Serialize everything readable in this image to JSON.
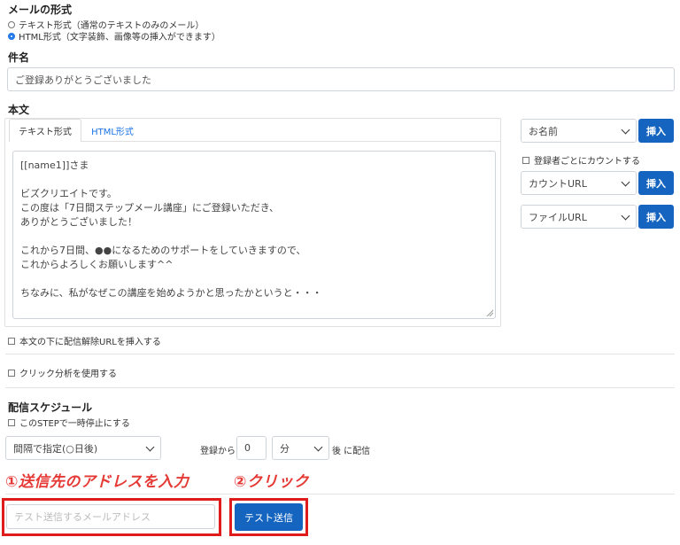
{
  "format": {
    "label": "メールの形式",
    "options": [
      {
        "label": "テキスト形式（通常のテキストのみのメール）",
        "selected": false
      },
      {
        "label": "HTML形式（文字装飾、画像等の挿入ができます）",
        "selected": true
      }
    ]
  },
  "subject": {
    "label": "件名",
    "value": "ご登録ありがとうございました"
  },
  "body": {
    "label": "本文",
    "tabs": [
      {
        "label": "テキスト形式",
        "active": true
      },
      {
        "label": "HTML形式",
        "active": false
      }
    ],
    "lines": [
      "[[name1]]さま",
      "",
      "ビズクリエイトです。",
      "この度は「7日間ステップメール講座」にご登録いただき、",
      "ありがとうございました！",
      "",
      "これから7日間、●●になるためのサポートをしていきますので、",
      "これからよろしくお願いします^^",
      "",
      "ちなみに、私がなぜこの講座を始めようかと思ったかというと・・・"
    ]
  },
  "side": {
    "name_select": "お名前",
    "insert_label": "挿入",
    "count_checkbox": "登録者ごとにカウントする",
    "count_url_select": "カウントURL",
    "file_url_select": "ファイルURL"
  },
  "options": {
    "unsubscribe": "本文の下に配信解除URLを挿入する",
    "click_analysis": "クリック分析を使用する"
  },
  "schedule": {
    "label": "配信スケジュール",
    "pause": "このSTEPで一時停止にする",
    "interval_select": "間隔で指定(○日後)",
    "from_label": "登録から",
    "amount": "0",
    "unit_select": "分",
    "after_label": "後 に配信"
  },
  "annotation": {
    "step1": "①送信先のアドレスを入力",
    "step2": "②クリック",
    "color": "#e53935"
  },
  "test": {
    "placeholder": "テスト送信するメールアドレス",
    "button": "テスト送信"
  }
}
